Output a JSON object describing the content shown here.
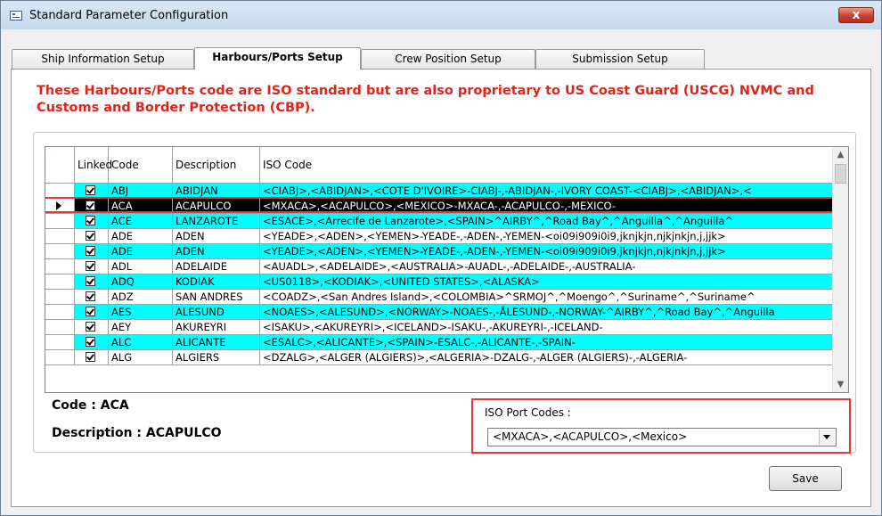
{
  "window": {
    "title": "Standard Parameter Configuration",
    "close_label": "x"
  },
  "tabs": [
    {
      "label": "Ship Information Setup"
    },
    {
      "label": "Harbours/Ports Setup"
    },
    {
      "label": "Crew Position Setup"
    },
    {
      "label": "Submission Setup"
    }
  ],
  "notice": "These Harbours/Ports code are ISO standard but are also proprietary to US Coast Guard (USCG) NVMC and Customs and Border Protection (CBP).",
  "grid": {
    "headers": {
      "linked": "Linked",
      "code": "Code",
      "description": "Description",
      "iso": "ISO Code"
    },
    "rows": [
      {
        "code": "ABJ",
        "description": "ABIDJAN",
        "iso": "<CIABJ>,<ABIDJAN>,<COTE D'IVOIRE>-CIABJ-,-ABIDJAN-,-IVORY COAST-<CIABJ>,<ABIDJAN>,<"
      },
      {
        "code": "ACA",
        "description": "ACAPULCO",
        "iso": "<MXACA>,<ACAPULCO>,<MEXICO>-MXACA-,-ACAPULCO-,-MEXICO-"
      },
      {
        "code": "ACE",
        "description": "LANZAROTE",
        "iso": "<ESACE>,<Arrecife de Lanzarote>,<SPAIN>^AIRBY^,^Road Bay^,^Anguilla^,^Anguilla^"
      },
      {
        "code": "ADE",
        "description": "ADEN",
        "iso": "<YEADE>,<ADEN>,<YEMEN>-YEADE-,-ADEN-,-YEMEN-<oi09i909i0i9,jknjkjn,njkjnkjn,j,jjk>"
      },
      {
        "code": "ADE",
        "description": "ADEN",
        "iso": "<YEADE>,<ADEN>,<YEMEN>-YEADE-,-ADEN-,-YEMEN-<oi09i909i0i9,jknjkjn,njkjnkjn,j,jjk>"
      },
      {
        "code": "ADL",
        "description": "ADELAIDE",
        "iso": "<AUADL>,<ADELAIDE>,<AUSTRALIA>-AUADL-,-ADELAIDE-,-AUSTRALIA-"
      },
      {
        "code": "ADQ",
        "description": "KODIAK",
        "iso": "<US0118>,<KODIAK>,<UNITED STATES>,<ALASKA>"
      },
      {
        "code": "ADZ",
        "description": "SAN ANDRES",
        "iso": "<COADZ>,<San Andres Island>,<COLOMBIA>^SRMOJ^,^Moengo^,^Suriname^,^Suriname^"
      },
      {
        "code": "AES",
        "description": "ALESUND",
        "iso": "<NOAES>,<ALESUND>,<NORWAY>-NOAES-,-ÅLESUND-,-NORWAY-^AIRBY^,^Road Bay^,^Anguilla"
      },
      {
        "code": "AEY",
        "description": "AKUREYRI",
        "iso": "<ISAKU>,<AKUREYRI>,<ICELAND>-ISAKU-,-AKUREYRI-,-ICELAND-"
      },
      {
        "code": "ALC",
        "description": "ALICANTE",
        "iso": "<ESALC>,<ALICANTE>,<SPAIN>-ESALC-,-ALICANTE-,-SPAIN-"
      },
      {
        "code": "ALG",
        "description": "ALGIERS",
        "iso": "<DZALG>,<ALGER (ALGIERS)>,<ALGERIA>-DZALG-,-ALGER (ALGIERS)-,-ALGERIA-"
      }
    ],
    "selected_index": 1
  },
  "details": {
    "code_label": "Code : ACA",
    "description_label": "Description : ACAPULCO",
    "iso_port_codes_label": "ISO Port Codes :",
    "iso_port_codes_value": "<MXACA>,<ACAPULCO>,<Mexico>"
  },
  "save_label": "Save",
  "colors": {
    "row_highlight": "#00ffff",
    "selected_row": "#000000",
    "notice_text": "#e2231a",
    "outline": "#e53935"
  }
}
